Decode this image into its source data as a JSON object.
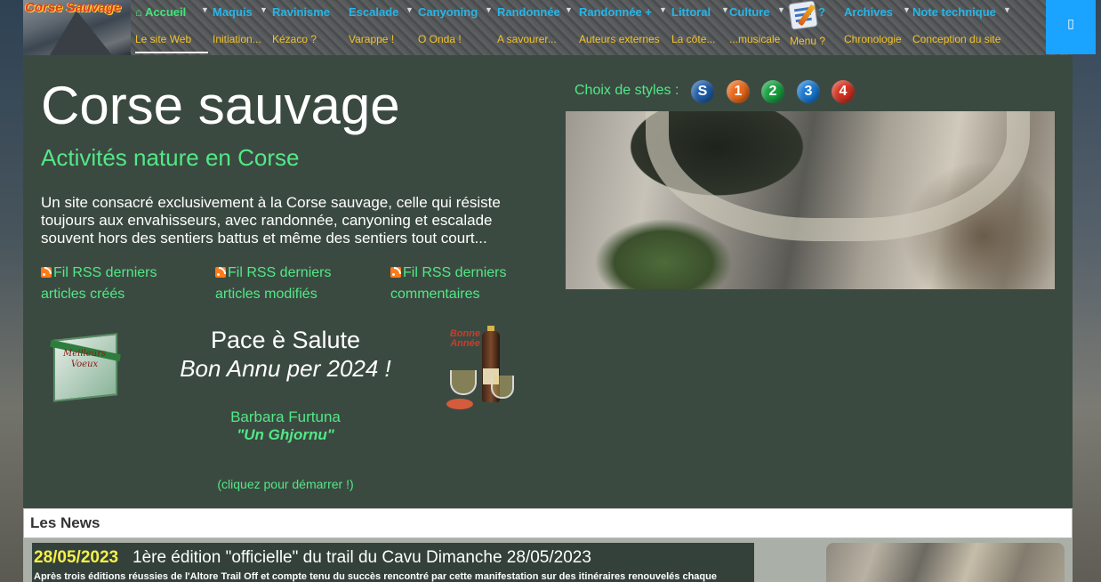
{
  "nav": {
    "logo_text": "Corse Sauvage",
    "items": [
      {
        "label": "Accueil",
        "sub": "Le site Web"
      },
      {
        "label": "Maquis",
        "sub": "Initiation..."
      },
      {
        "label": "Ravinisme",
        "sub": "Kézaco ?"
      },
      {
        "label": "Escalade",
        "sub": "Varappe !"
      },
      {
        "label": "Canyoning",
        "sub": "O Onda !"
      },
      {
        "label": "Randonnée",
        "sub": "A savourer..."
      },
      {
        "label": "Randonnée +",
        "sub": "Auteurs externes"
      },
      {
        "label": "Littoral",
        "sub": "La côte..."
      },
      {
        "label": "Culture",
        "sub": "...musicale"
      },
      {
        "label": "?",
        "sub": "Menu ?"
      },
      {
        "label": "Archives",
        "sub": "Chronologie"
      },
      {
        "label": "Note technique",
        "sub": "Conception du site"
      }
    ],
    "right_button_glyph": "▯"
  },
  "header": {
    "title": "Corse sauvage",
    "subtitle": "Activités nature en Corse",
    "description": "Un site consacré exclusivement à la Corse sauvage, celle qui résiste toujours aux envahisseurs, avec randonnée, canyoning et escalade souvent hors des sentiers battus et même des sentiers tout court...",
    "rss": [
      {
        "line1": "Fil RSS derniers",
        "line2": "articles créés"
      },
      {
        "line1": "Fil RSS derniers",
        "line2": "articles modifiés"
      },
      {
        "line1": "Fil RSS derniers",
        "line2": "commentaires"
      }
    ],
    "greeting_card_text": "Meilleurs Voeux",
    "greeting_line1": "Pace è Salute",
    "greeting_line2": "Bon Annu per 2024 !",
    "song_artist": "Barbara Furtuna",
    "song_title": "\"Un Ghjornu\"",
    "click_to_start": "(cliquez pour démarrer !)",
    "champagne_text": "Bonne Année",
    "styles_label": "Choix de styles :",
    "style_buttons": [
      {
        "label": "S",
        "color": "#1f5ea8"
      },
      {
        "label": "1",
        "color": "#e8681a"
      },
      {
        "label": "2",
        "color": "#18a040"
      },
      {
        "label": "3",
        "color": "#1a78d0"
      },
      {
        "label": "4",
        "color": "#d43320"
      }
    ]
  },
  "news": {
    "section_title": "Les News",
    "items": [
      {
        "date": "28/05/2023",
        "title": "1ère édition \"officielle\" du trail du Cavu Dimanche 28/05/2023",
        "excerpt": "Après trois éditions réussies de l'Altore Trail Off et compte tenu du succès rencontré par cette manifestation sur des itinéraires renouvelés chaque"
      }
    ]
  },
  "colors": {
    "accent_green": "#52e886",
    "nav_blue": "#27b5e8",
    "nav_yellow": "#f2c22a",
    "panel_bg": "#3b4a41",
    "date_yellow": "#f5f04a"
  }
}
